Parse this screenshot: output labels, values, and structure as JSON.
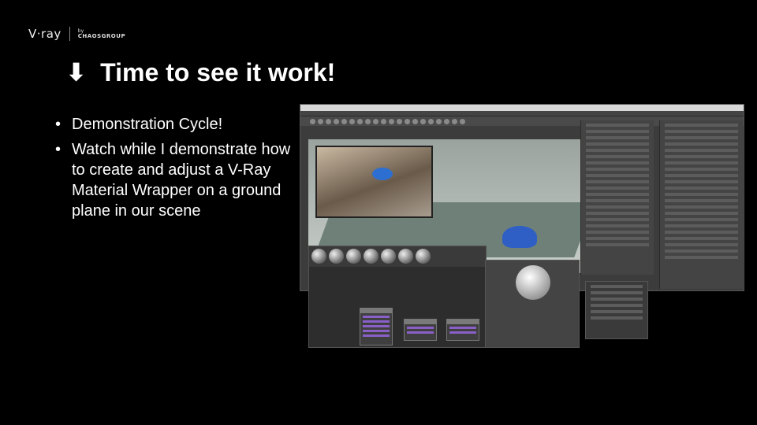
{
  "logo": {
    "vray": "V·ray",
    "by": "by",
    "chaos": "CHAOSGROUP"
  },
  "title": {
    "icon": "arrow-down-icon",
    "glyph": "⬇",
    "text": "Time to see it work!"
  },
  "bullets": [
    "Demonstration Cycle!",
    "Watch while I demonstrate how to create and adjust a V-Ray Material Wrapper on a ground plane in our scene"
  ],
  "colors": {
    "background": "#000000",
    "text": "#ffffff",
    "material_blue": "#2f5fc4"
  }
}
